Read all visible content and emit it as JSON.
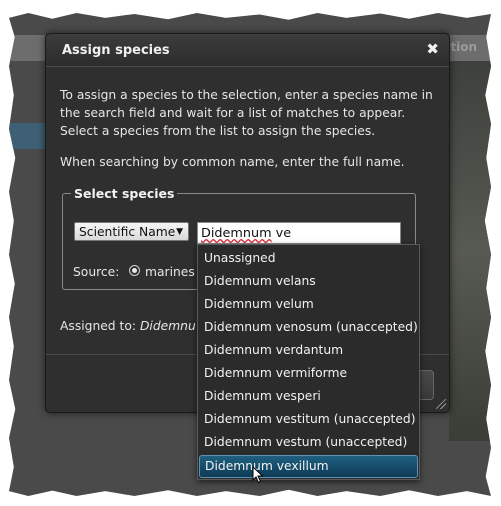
{
  "background": {
    "header_text": "ation"
  },
  "dialog": {
    "title": "Assign species",
    "close_glyph": "✖",
    "instructions": "To assign a species to the selection, enter a species name in the search field and wait for a list of matches to appear. Select a species from the list to assign the species.",
    "note": "When searching by common name, enter the full name.",
    "fieldset_legend": "Select species",
    "name_type": {
      "selected": "Scientific Name",
      "caret": "▼"
    },
    "search": {
      "value_first": "Didemnum",
      "value_rest": " ve"
    },
    "source": {
      "label": "Source:",
      "selected": "marines"
    },
    "assigned": {
      "label": "Assigned to:",
      "value": "Didemnu"
    }
  },
  "dropdown": {
    "items": [
      "Unassigned",
      "Didemnum velans",
      "Didemnum velum",
      "Didemnum venosum (unaccepted)",
      "Didemnum verdantum",
      "Didemnum vermiforme",
      "Didemnum vesperi",
      "Didemnum vestitum (unaccepted)",
      "Didemnum vestum (unaccepted)",
      "Didemnum vexillum"
    ],
    "highlighted_index": 9
  },
  "colors": {
    "dialog_bg": "#2f2f2f",
    "highlight": "#1f5f80"
  }
}
